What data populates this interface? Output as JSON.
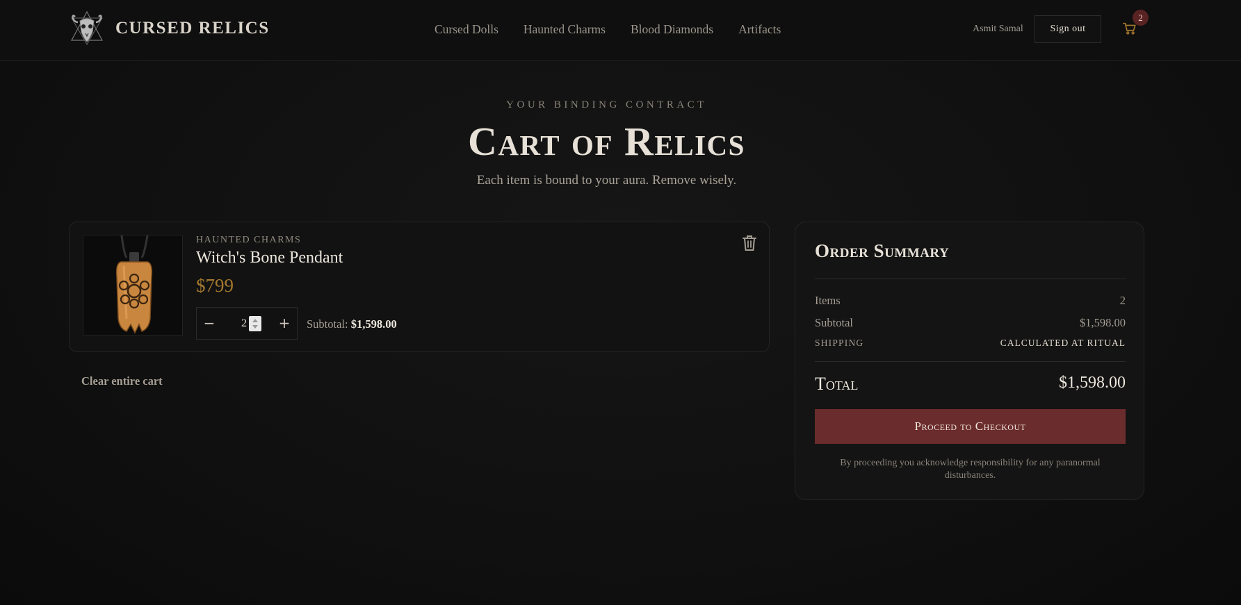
{
  "brand": {
    "name": "CURSED RELICS",
    "logo_icon": "goat-skull-pentagram-icon"
  },
  "nav": {
    "items": [
      {
        "label": "Cursed Dolls"
      },
      {
        "label": "Haunted Charms"
      },
      {
        "label": "Blood Diamonds"
      },
      {
        "label": "Artifacts"
      }
    ]
  },
  "user": {
    "name": "Asmit Samal",
    "signout_label": "Sign out"
  },
  "cart": {
    "badge_count": "2",
    "icon": "cart-icon"
  },
  "hero": {
    "eyebrow": "YOUR BINDING CONTRACT",
    "title": "Cart of Relics",
    "subtitle": "Each item is bound to your aura. Remove wisely."
  },
  "items": [
    {
      "category": "HAUNTED CHARMS",
      "name": "Witch's Bone Pendant",
      "price": "$799",
      "quantity": "2",
      "subtotal_label": "Subtotal:",
      "subtotal_value": "$1,598.00",
      "remove_icon": "trash-icon"
    }
  ],
  "clear_cart_label": "Clear entire cart",
  "summary": {
    "title": "Order Summary",
    "items_label": "Items",
    "items_value": "2",
    "subtotal_label": "Subtotal",
    "subtotal_value": "$1,598.00",
    "shipping_label": "SHIPPING",
    "shipping_value": "CALCULATED AT RITUAL",
    "total_label": "Total",
    "total_value": "$1,598.00",
    "checkout_label": "Proceed to Checkout",
    "disclaimer": "By proceeding you acknowledge responsibility for any paranormal disturbances."
  },
  "colors": {
    "accent_gold": "#a4782e",
    "checkout_red": "#6a2c2c",
    "badge_red": "#5a2323",
    "background": "#101010"
  }
}
